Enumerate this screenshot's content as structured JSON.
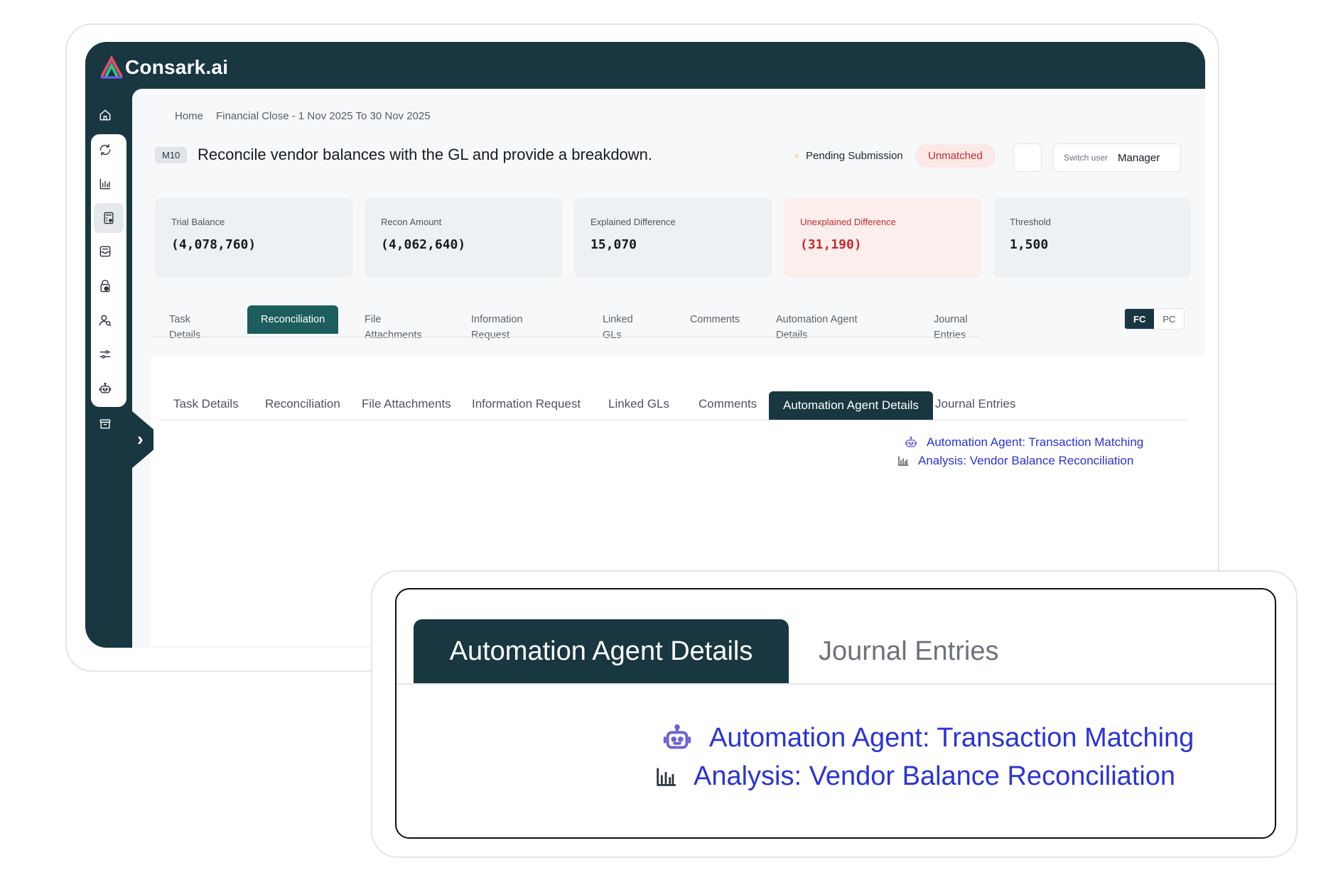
{
  "brand": {
    "logo_text": "Consark.ai",
    "accent": "#193741",
    "tab_active": "#1d5d5d"
  },
  "breadcrumb": [
    "Home",
    "Financial Close - 1 Nov 2025 To 30 Nov 2025"
  ],
  "task": {
    "code": "M10",
    "title": "Reconcile vendor balances with the GL and provide a breakdown.",
    "status": "Pending Submission",
    "match_status": "Unmatched"
  },
  "switch_user": {
    "label": "Switch user",
    "value": "Manager"
  },
  "kpis": [
    {
      "label": "Trial Balance",
      "value": "(4,078,760)"
    },
    {
      "label": "Recon Amount",
      "value": "(4,062,640)"
    },
    {
      "label": "Explained Difference",
      "value": "15,070"
    },
    {
      "label": "Unexplained Difference",
      "value": "(31,190)"
    },
    {
      "label": "Threshold",
      "value": "1,500"
    }
  ],
  "primary_tabs": [
    {
      "line1": "Task",
      "line2": "Details"
    },
    {
      "line1": "Reconciliation",
      "line2": ""
    },
    {
      "line1": "File",
      "line2": "Attachments"
    },
    {
      "line1": "Information",
      "line2": "Request"
    },
    {
      "line1": "Linked",
      "line2": "GLs"
    },
    {
      "line1": "Comments",
      "line2": ""
    },
    {
      "line1": "Automation Agent",
      "line2": "Details"
    },
    {
      "line1": "Journal",
      "line2": "Entries"
    }
  ],
  "toggle": {
    "fc": "FC",
    "pc": "PC"
  },
  "secondary_tabs": [
    "Task Details",
    "Reconciliation",
    "File Attachments",
    "Information Request",
    "Linked GLs",
    "Comments",
    "Automation Agent Details",
    "Journal Entries"
  ],
  "agent_links": [
    {
      "icon": "robot-icon",
      "text": "Automation Agent: Transaction Matching"
    },
    {
      "icon": "bar-chart-icon",
      "text": "Analysis: Vendor Balance Reconciliation"
    }
  ],
  "zoom": {
    "active_tab": "Automation Agent Details",
    "tab": "Journal Entries"
  },
  "sidebar_icons": [
    "home-icon",
    "sync-icon",
    "bar-chart-icon",
    "calculator-icon",
    "inbox-icon",
    "lock-icon",
    "user-search-icon",
    "sliders-icon",
    "robot-icon",
    "archive-icon"
  ]
}
